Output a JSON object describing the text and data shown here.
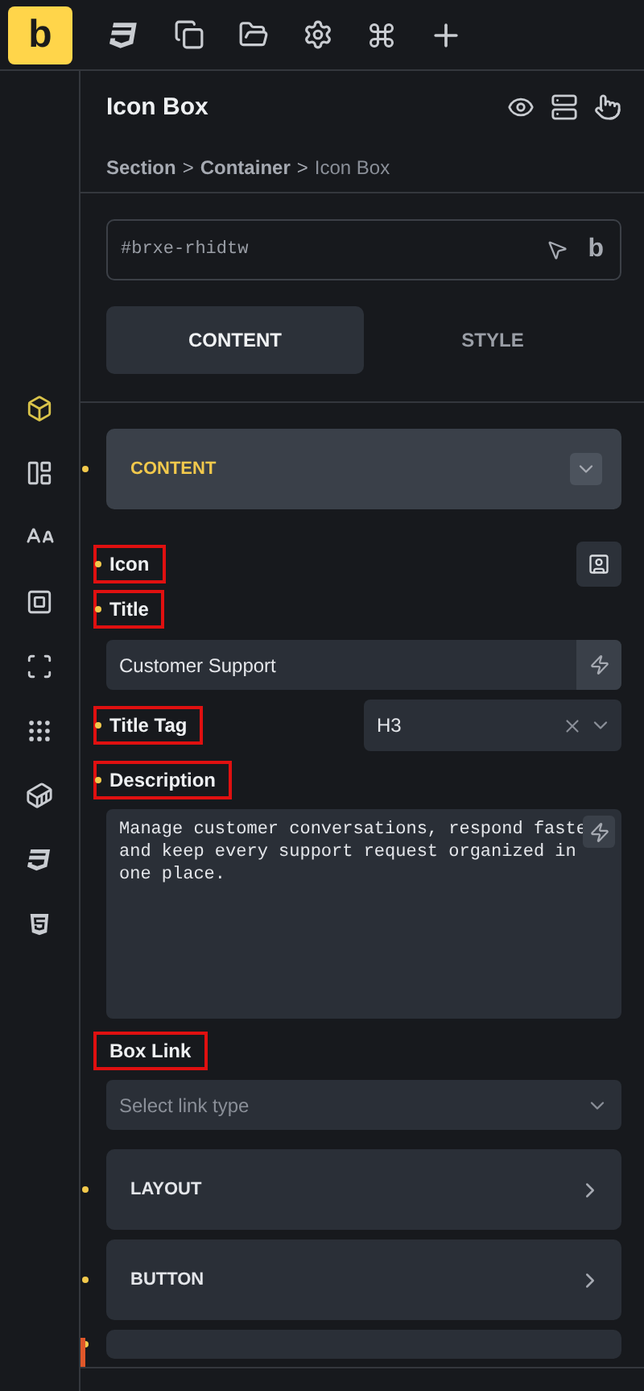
{
  "logo": "b",
  "rail": [
    {
      "selected": true
    },
    {
      "selected": false
    },
    {
      "selected": false
    },
    {
      "selected": false
    },
    {
      "selected": false
    },
    {
      "selected": false
    },
    {
      "selected": false
    },
    {
      "selected": false
    },
    {
      "selected": false
    }
  ],
  "panel": {
    "title": "Icon Box",
    "breadcrumbs": [
      {
        "label": "Section",
        "current": false
      },
      {
        "label": "Container",
        "current": false
      },
      {
        "label": "Icon Box",
        "current": true
      }
    ],
    "separator": ">"
  },
  "element_id": {
    "value": "#brxe-rhidtw",
    "badge": "b"
  },
  "tabs": [
    {
      "label": "CONTENT",
      "selected": true
    },
    {
      "label": "STYLE",
      "selected": false
    }
  ],
  "sections": [
    {
      "label": "CONTENT",
      "expanded": true,
      "modified": true,
      "fields": [
        {
          "kind": "icon",
          "label": "Icon",
          "modified": true,
          "highlighted": true
        },
        {
          "kind": "text",
          "label": "Title",
          "modified": true,
          "highlighted": true,
          "value": "Customer Support"
        },
        {
          "kind": "select",
          "label": "Title Tag",
          "modified": true,
          "highlighted": true,
          "value": "H3"
        },
        {
          "kind": "textarea",
          "label": "Description",
          "modified": true,
          "highlighted": true,
          "lines": [
            "Manage customer conversations, respond faste",
            "and keep every support request organized in",
            "one place."
          ]
        },
        {
          "kind": "block_select",
          "label": "Box Link",
          "modified": false,
          "highlighted": true,
          "placeholder": "Select link type"
        }
      ]
    },
    {
      "label": "LAYOUT",
      "expanded": false,
      "modified": true
    },
    {
      "label": "BUTTON",
      "expanded": false,
      "modified": true
    },
    {
      "expanded": false,
      "modified": true
    }
  ]
}
